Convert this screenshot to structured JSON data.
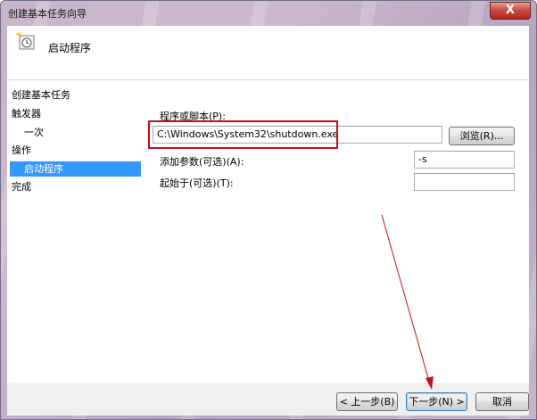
{
  "window": {
    "title": "创建基本任务向导",
    "close_glyph": "X"
  },
  "header": {
    "title": "启动程序"
  },
  "nav": {
    "section": "创建基本任务",
    "items": [
      {
        "label": "触发器"
      },
      {
        "label": "一次"
      },
      {
        "label": "操作"
      },
      {
        "label": "启动程序"
      },
      {
        "label": "完成"
      }
    ]
  },
  "form": {
    "program_label": "程序或脚本(P):",
    "program_value": "C:\\Windows\\System32\\shutdown.exe",
    "browse_label": "浏览(R)...",
    "args_label": "添加参数(可选)(A):",
    "args_value": "-s",
    "start_in_label": "起始于(可选)(T):",
    "start_in_value": ""
  },
  "buttons": {
    "back": "< 上一步(B)",
    "next": "下一步(N) >",
    "cancel": "取消"
  },
  "colors": {
    "selection": "#3399ff",
    "highlight_box": "#c0111b",
    "arrow": "#c0111b"
  }
}
